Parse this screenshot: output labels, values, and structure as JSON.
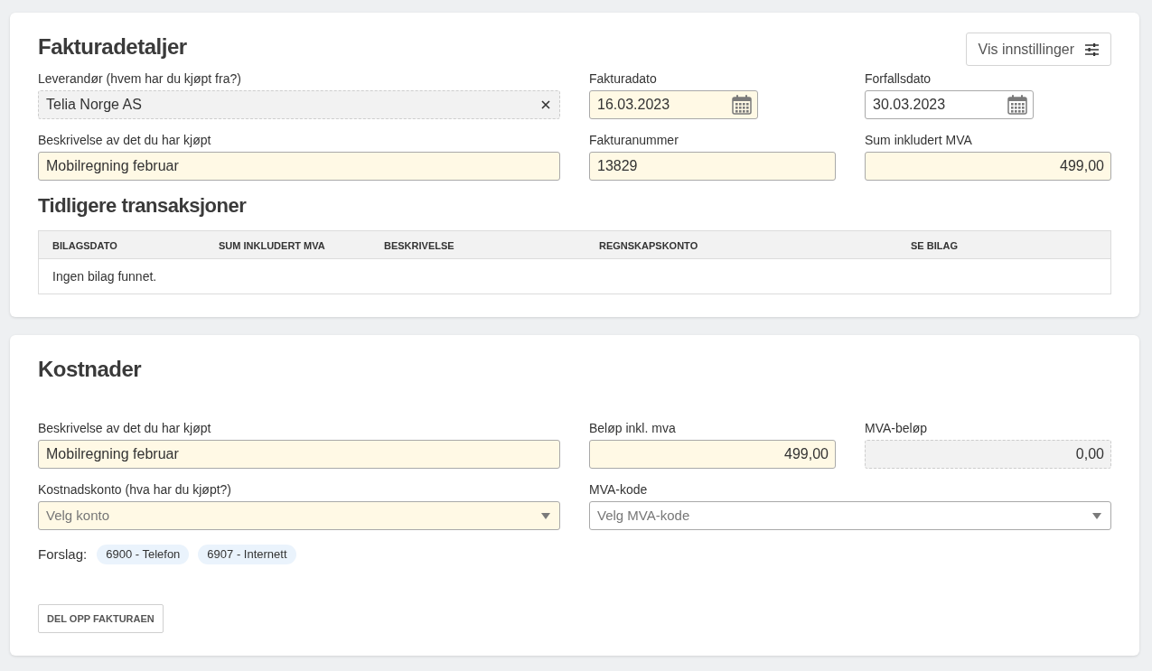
{
  "invoice_details": {
    "title": "Fakturadetaljer",
    "settings_button": {
      "label": "Vis innstillinger"
    },
    "rows": [
      [
        {
          "kind": "clearable",
          "label": "Leverandør (hvem har du kjøpt fra?)",
          "value": "Telia Norge AS",
          "highlighted": false,
          "disabled": true
        },
        {
          "kind": "date",
          "label": "Fakturadato",
          "value": "16.03.2023",
          "highlighted": true,
          "disabled": false
        },
        {
          "kind": "date",
          "label": "Forfallsdato",
          "value": "30.03.2023",
          "highlighted": false,
          "disabled": false
        }
      ],
      [
        {
          "kind": "text",
          "label": "Beskrivelse av det du har kjøpt",
          "value": "Mobilregning februar",
          "highlighted": true,
          "disabled": false
        },
        {
          "kind": "text",
          "label": "Fakturanummer",
          "value": "13829",
          "highlighted": true,
          "disabled": false
        },
        {
          "kind": "amount",
          "label": "Sum inkludert MVA",
          "value": "499,00",
          "highlighted": true,
          "disabled": false
        }
      ]
    ]
  },
  "previous_transactions": {
    "title": "Tidligere transaksjoner",
    "columns": [
      "BILAGSDATO",
      "SUM INKLUDERT MVA",
      "BESKRIVELSE",
      "REGNSKAPSKONTO",
      "SE BILAG"
    ],
    "empty_message": "Ingen bilag funnet."
  },
  "costs": {
    "title": "Kostnader",
    "rows": [
      [
        {
          "kind": "text",
          "label": "Beskrivelse av det du har kjøpt",
          "value": "Mobilregning februar",
          "highlighted": true,
          "disabled": false
        },
        {
          "kind": "amount",
          "label": "Beløp inkl. mva",
          "value": "499,00",
          "highlighted": true,
          "disabled": false
        },
        {
          "kind": "amount",
          "label": "MVA-beløp",
          "value": "0,00",
          "highlighted": false,
          "disabled": true
        }
      ],
      [
        {
          "kind": "select",
          "label": "Kostnadskonto (hva har du kjøpt?)",
          "placeholder": "Velg konto",
          "highlighted": true,
          "disabled": false
        },
        {
          "kind": "select",
          "label": "MVA-kode",
          "placeholder": "Velg MVA-kode",
          "highlighted": false,
          "disabled": false
        }
      ]
    ],
    "suggestions": {
      "label": "Forslag:",
      "items": [
        "6900 - Telefon",
        "6907 - Internett"
      ]
    },
    "split_button": "DEL OPP FAKTURAEN"
  }
}
